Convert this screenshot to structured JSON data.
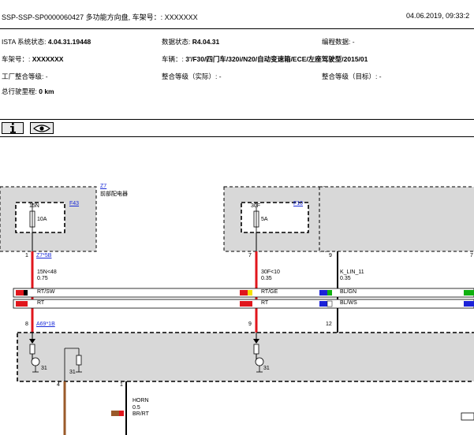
{
  "header": {
    "doc_title": "SSP-SSP-SP0000060427 多功能方向盘, 车架号：: XXXXXXX",
    "datetime": "04.06.2019, 09:33:2"
  },
  "info": {
    "ista_label": "ISTA 系统状态: ",
    "ista_value": "4.04.31.19448",
    "data_label": "数据状态: ",
    "data_value": "R4.04.31",
    "prog_label": "编程数据: -",
    "vin_label": "车架号：: ",
    "vin_value": "XXXXXXX",
    "vehicle_label": "车辆：: ",
    "vehicle_value": "3'/F30/四门车/320i/N20/自动变速箱/ECE/左座驾驶型/2015/01",
    "factory_label": "工厂整合等级: -",
    "actual_label": "整合等级（实际）: -",
    "target_label": "整合等级（目标）: -",
    "mileage_label": "总行驶里程: ",
    "mileage_value": "0 km"
  },
  "toolbar": {
    "info_icon": "info-icon",
    "view_icon": "eye-icon"
  },
  "colors": {
    "red": "#e0161c",
    "black": "#000000",
    "brown": "#9a5a2a",
    "yellow": "#f3e000",
    "green": "#10b010",
    "blue": "#1b22d8",
    "white": "#ffffff",
    "box_gray": "#d8d8d8"
  },
  "diagram": {
    "z7_label": "Z7",
    "z7_desc": "前部配电器",
    "f43_link": "F43",
    "f43_code": "15N",
    "f43_amp": "10A",
    "f10_link": "F10",
    "f10_code": "30F",
    "f10_amp": "5A",
    "pin1": "1",
    "pin7": "7",
    "pin9a": "9",
    "pin7b": "7",
    "conn_z7": "Z7*5B",
    "w1_name": "15N<48",
    "w1_size": "0.75",
    "w2_name": "30F<10",
    "w2_size": "0.35",
    "w3_name": "K_LIN_11",
    "w3_size": "0.35",
    "w1_c1": "RT/SW",
    "w1_c2": "RT",
    "w2_c1": "RT/GE",
    "w2_c2": "RT",
    "w3_c1": "BL/GN",
    "w3_c2": "BL/WS",
    "pin8": "8",
    "conn_a69": "A69*1B",
    "pin9b": "9",
    "pin12": "12",
    "gnd31a": "31",
    "gnd31b": "31",
    "gnd31c": "31",
    "pin4": "4",
    "pin1b": "1",
    "horn_name": "HORN",
    "horn_size": "0.5",
    "horn_color": "BR/RT"
  }
}
